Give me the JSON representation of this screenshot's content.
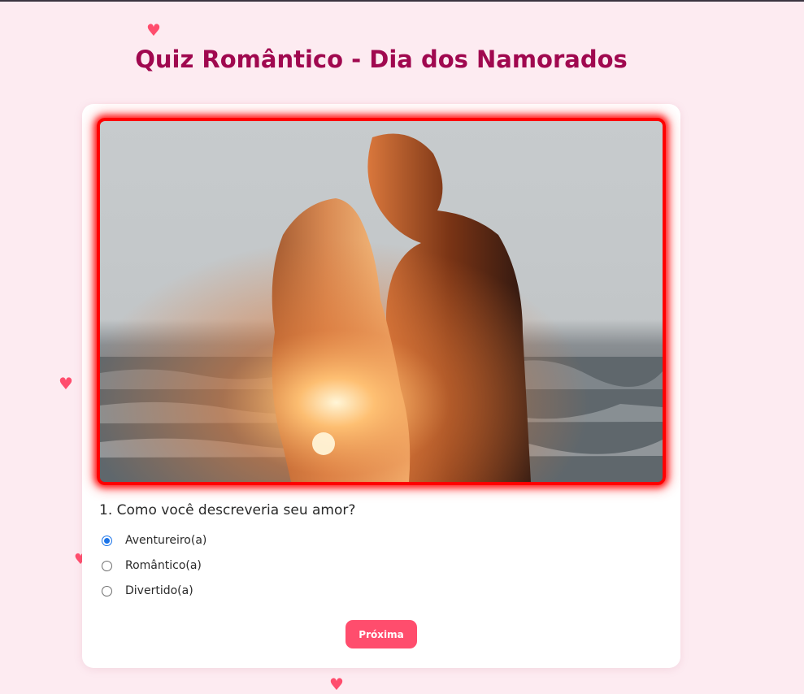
{
  "page": {
    "title": "Quiz Romântico - Dia dos Namorados"
  },
  "quiz": {
    "question": "1. Como você descreveria seu amor?",
    "options": [
      {
        "label": "Aventureiro(a)",
        "selected": true
      },
      {
        "label": "Romântico(a)",
        "selected": false
      },
      {
        "label": "Divertido(a)",
        "selected": false
      }
    ],
    "next_label": "Próxima"
  },
  "icons": {
    "decoration": "heart-icon"
  },
  "colors": {
    "background": "#fdebf1",
    "title": "#a0084f",
    "photo_border": "#ff0000",
    "button": "#ff4d6d",
    "heart": "#ff4d6d",
    "radio_selected": "#1a73e8"
  }
}
